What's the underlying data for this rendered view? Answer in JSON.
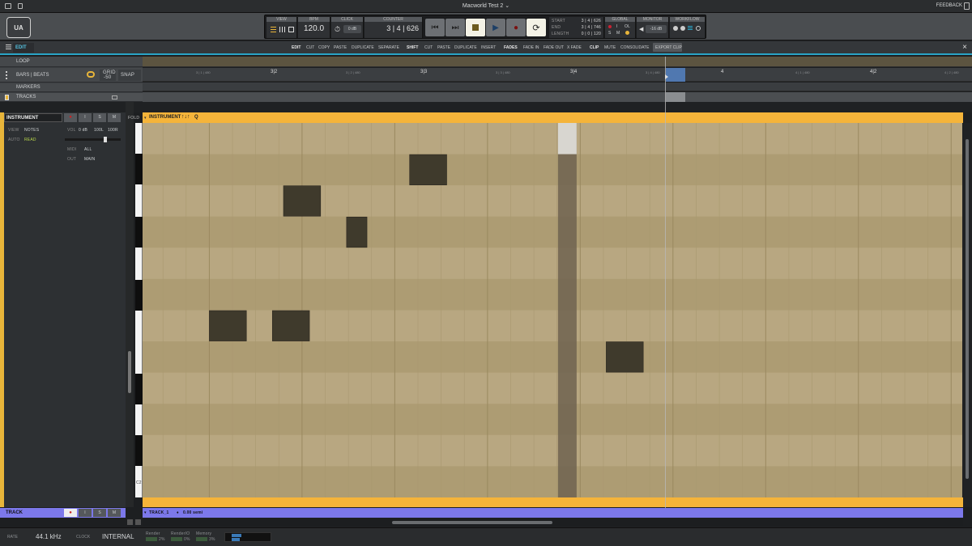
{
  "window": {
    "title": "Macworld Test 2",
    "feedback": "FEEDBACK"
  },
  "logo": "UA",
  "transport": {
    "view_label": "VIEW",
    "bpm_label": "BPM",
    "bpm": "120.0",
    "click_label": "CLICK",
    "click_value": "0 dB",
    "counter_label": "COUNTER",
    "counter": "3 | 4 | 626",
    "start_label": "START",
    "end_label": "END",
    "length_label": "LENGTH",
    "start": "3 | 4 | 626",
    "end": "3 | 4 | 746",
    "length": "0 | 0 | 120",
    "global_label": "GLOBAL",
    "global_ol": "OL",
    "global_s": "S",
    "global_m": "M",
    "global_i": "I",
    "monitor_label": "MONITOR",
    "monitor_value": "-16 dB",
    "workflow_label": "WORKFLOW"
  },
  "editbar": {
    "mode": "EDIT",
    "edit": "EDIT",
    "cut": "CUT",
    "copy": "COPY",
    "paste": "PASTE",
    "duplicate": "DUPLICATE",
    "separate": "SEPARATE",
    "shift": "SHIFT",
    "shift_cut": "CUT",
    "shift_paste": "PASTE",
    "shift_duplicate": "DUPLICATE",
    "insert": "INSERT",
    "fades": "FADES",
    "fade_in": "FADE IN",
    "fade_out": "FADE OUT",
    "x_fade": "X FADE",
    "clip": "CLIP",
    "mute": "MUTE",
    "consolidate": "CONSOLIDATE",
    "export_clip": "EXPORT CLIP"
  },
  "lanes": {
    "loop": "LOOP",
    "bars_beats": "BARS | BEATS",
    "grid_label": "GRID",
    "grid_value": "-50",
    "snap": "SNAP",
    "markers": "MARKERS",
    "tracks": "TRACKS"
  },
  "ruler": {
    "major": [
      "3|2",
      "3|3",
      "3|4",
      "4",
      "4|2"
    ],
    "minor": [
      "3 | 1 | 480",
      "3 | 2 | 480",
      "3 | 3 | 480",
      "3 | 4 | 480",
      "4 | 1 | 480",
      "4 | 2 | 480"
    ]
  },
  "instrument": {
    "name": "INSTRUMENT",
    "rec": "●",
    "i": "I",
    "s": "S",
    "m": "M",
    "view_label": "VIEW",
    "view_value": "NOTES",
    "auto_label": "AUTO",
    "auto_value": "READ",
    "vol_label": "VOL",
    "vol_value": "0 dB",
    "pan_l": "100L",
    "pan_r": "100R",
    "midi_label": "MIDI",
    "midi_value": "ALL",
    "out_label": "OUT",
    "out_value": "MAIN",
    "fold": "FOLD",
    "clip_name": "INSTRUMENT",
    "q": "Q",
    "c2": "C2",
    "playhead_beat": 3.94
  },
  "piano_roll": {
    "x_start_beat": 2.82,
    "x_end_beat": 5.03,
    "pitch_rows": 12,
    "notes": [
      {
        "row": 1,
        "start": 3.54,
        "length": 0.1
      },
      {
        "row": 2,
        "start": 3.2,
        "length": 0.1
      },
      {
        "row": 3,
        "start": 3.37,
        "length": 0.055
      },
      {
        "row": 6,
        "start": 3.0,
        "length": 0.1
      },
      {
        "row": 6,
        "start": 3.17,
        "length": 0.1
      },
      {
        "row": 7,
        "start": 4.07,
        "length": 0.1
      }
    ]
  },
  "track": {
    "name": "TRACK",
    "rec": "●",
    "i": "I",
    "s": "S",
    "m": "M",
    "clip": "TRACK_1",
    "pitch": "0.00 semi"
  },
  "status": {
    "rate_label": "RATE",
    "rate": "44.1 kHz",
    "clock_label": "CLOCK",
    "clock": "INTERNAL",
    "render_label": "Render",
    "render_value": "2%",
    "renderio_label": "RenderIO",
    "renderio_value": "0%",
    "memory_label": "Memory",
    "memory_value": "3%"
  }
}
